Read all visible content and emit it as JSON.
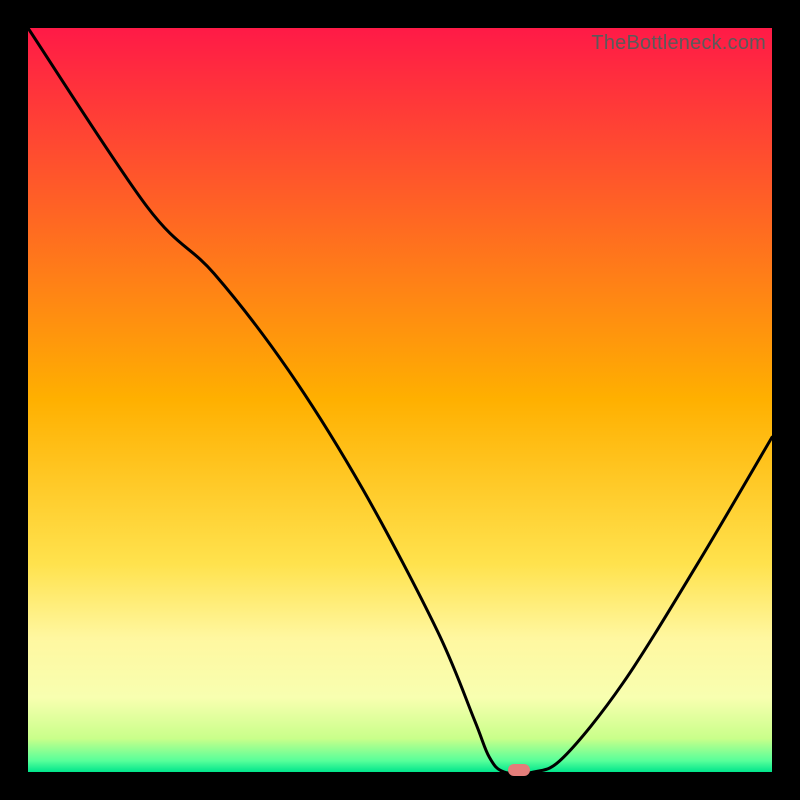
{
  "watermark": {
    "text": "TheBottleneck.com"
  },
  "colors": {
    "black": "#000000",
    "line": "#000000",
    "marker": "#e47d7a",
    "gradient_stops": [
      {
        "offset": 0.0,
        "color": "#ff1a47"
      },
      {
        "offset": 0.5,
        "color": "#ffb000"
      },
      {
        "offset": 0.72,
        "color": "#ffe24d"
      },
      {
        "offset": 0.82,
        "color": "#fff7a0"
      },
      {
        "offset": 0.9,
        "color": "#f8ffb0"
      },
      {
        "offset": 0.955,
        "color": "#c9ff8a"
      },
      {
        "offset": 0.985,
        "color": "#57ff9a"
      },
      {
        "offset": 1.0,
        "color": "#00e58c"
      }
    ]
  },
  "chart_data": {
    "type": "line",
    "title": "",
    "xlabel": "",
    "ylabel": "",
    "xlim": [
      0,
      100
    ],
    "ylim": [
      0,
      100
    ],
    "x": [
      0,
      16,
      25,
      35,
      45,
      55,
      60,
      62,
      64,
      68,
      72,
      80,
      90,
      100
    ],
    "values": [
      100,
      76,
      67,
      54,
      38,
      19,
      7,
      2,
      0,
      0,
      2,
      12,
      28,
      45
    ],
    "marker": {
      "x": 66,
      "y": 0
    },
    "annotations": []
  }
}
